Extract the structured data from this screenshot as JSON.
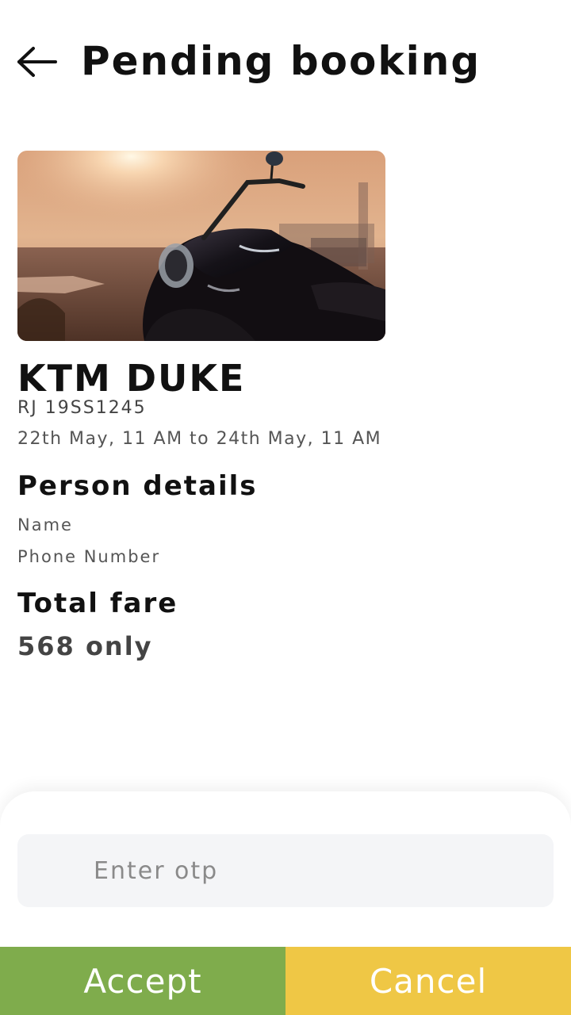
{
  "header": {
    "back_icon": "arrow-left-icon",
    "title": "Pending booking"
  },
  "vehicle": {
    "image_icon": "motorcycle-photo",
    "name": "KTM DUKE",
    "plate": "RJ 19SS1245",
    "period": "22th May, 11 AM to 24th May, 11 AM"
  },
  "person": {
    "heading": "Person details",
    "name_label": "Name",
    "phone_label": "Phone Number"
  },
  "fare": {
    "heading": "Total fare",
    "value": "568 only"
  },
  "otp": {
    "placeholder": "Enter otp",
    "value": ""
  },
  "actions": {
    "accept_label": "Accept",
    "cancel_label": "Cancel"
  },
  "colors": {
    "accept": "#7fac4c",
    "cancel": "#efc745",
    "otp_field_bg": "#f4f5f7"
  }
}
